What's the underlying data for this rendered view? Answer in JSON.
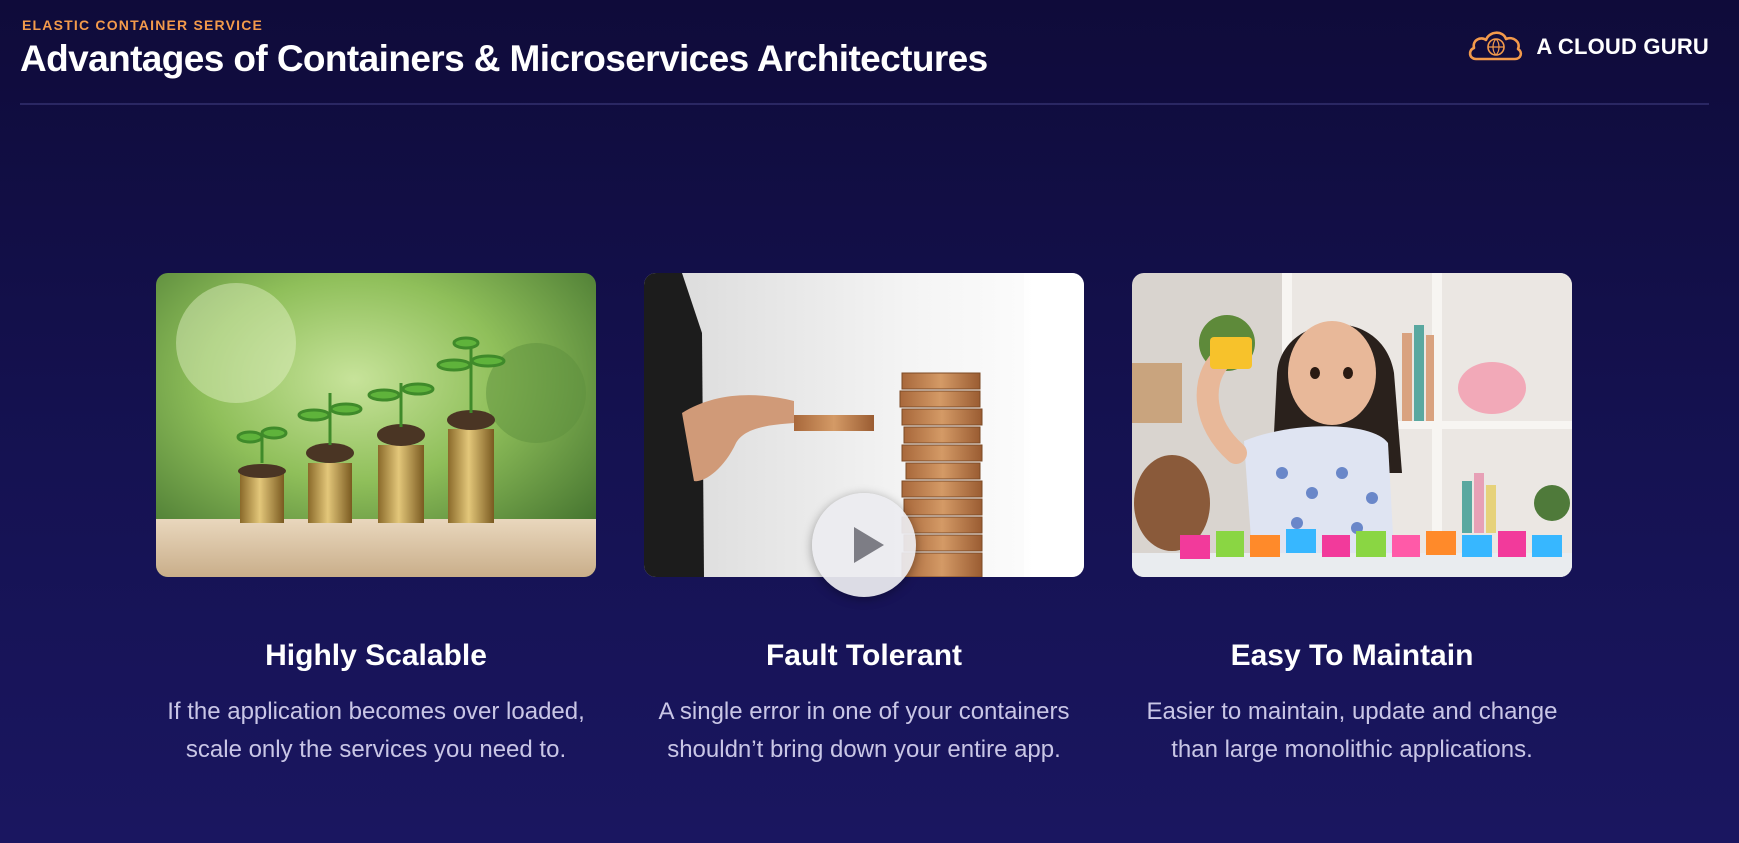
{
  "header": {
    "eyebrow": "ELASTIC CONTAINER SERVICE",
    "title": "Advantages of Containers & Microservices Architectures"
  },
  "brand": {
    "name": "A CLOUD GURU",
    "icon": "cloud-logo-icon"
  },
  "colors": {
    "accent": "#f39a4b",
    "background": "#151252",
    "body_text": "#c9c6e6"
  },
  "cards": [
    {
      "image": "coins-with-seedlings-photo",
      "title": "Highly Scalable",
      "text": "If the application becomes over loaded, scale only the services you need to."
    },
    {
      "image": "jenga-tower-photo",
      "title": "Fault Tolerant",
      "text": "A single error in one of your containers shouldn’t bring down your entire app."
    },
    {
      "image": "girl-with-toy-blocks-photo",
      "title": "Easy To Maintain",
      "text": "Easier to maintain, update and change than large monolithic applications."
    }
  ],
  "player": {
    "play_icon": "play-icon"
  }
}
